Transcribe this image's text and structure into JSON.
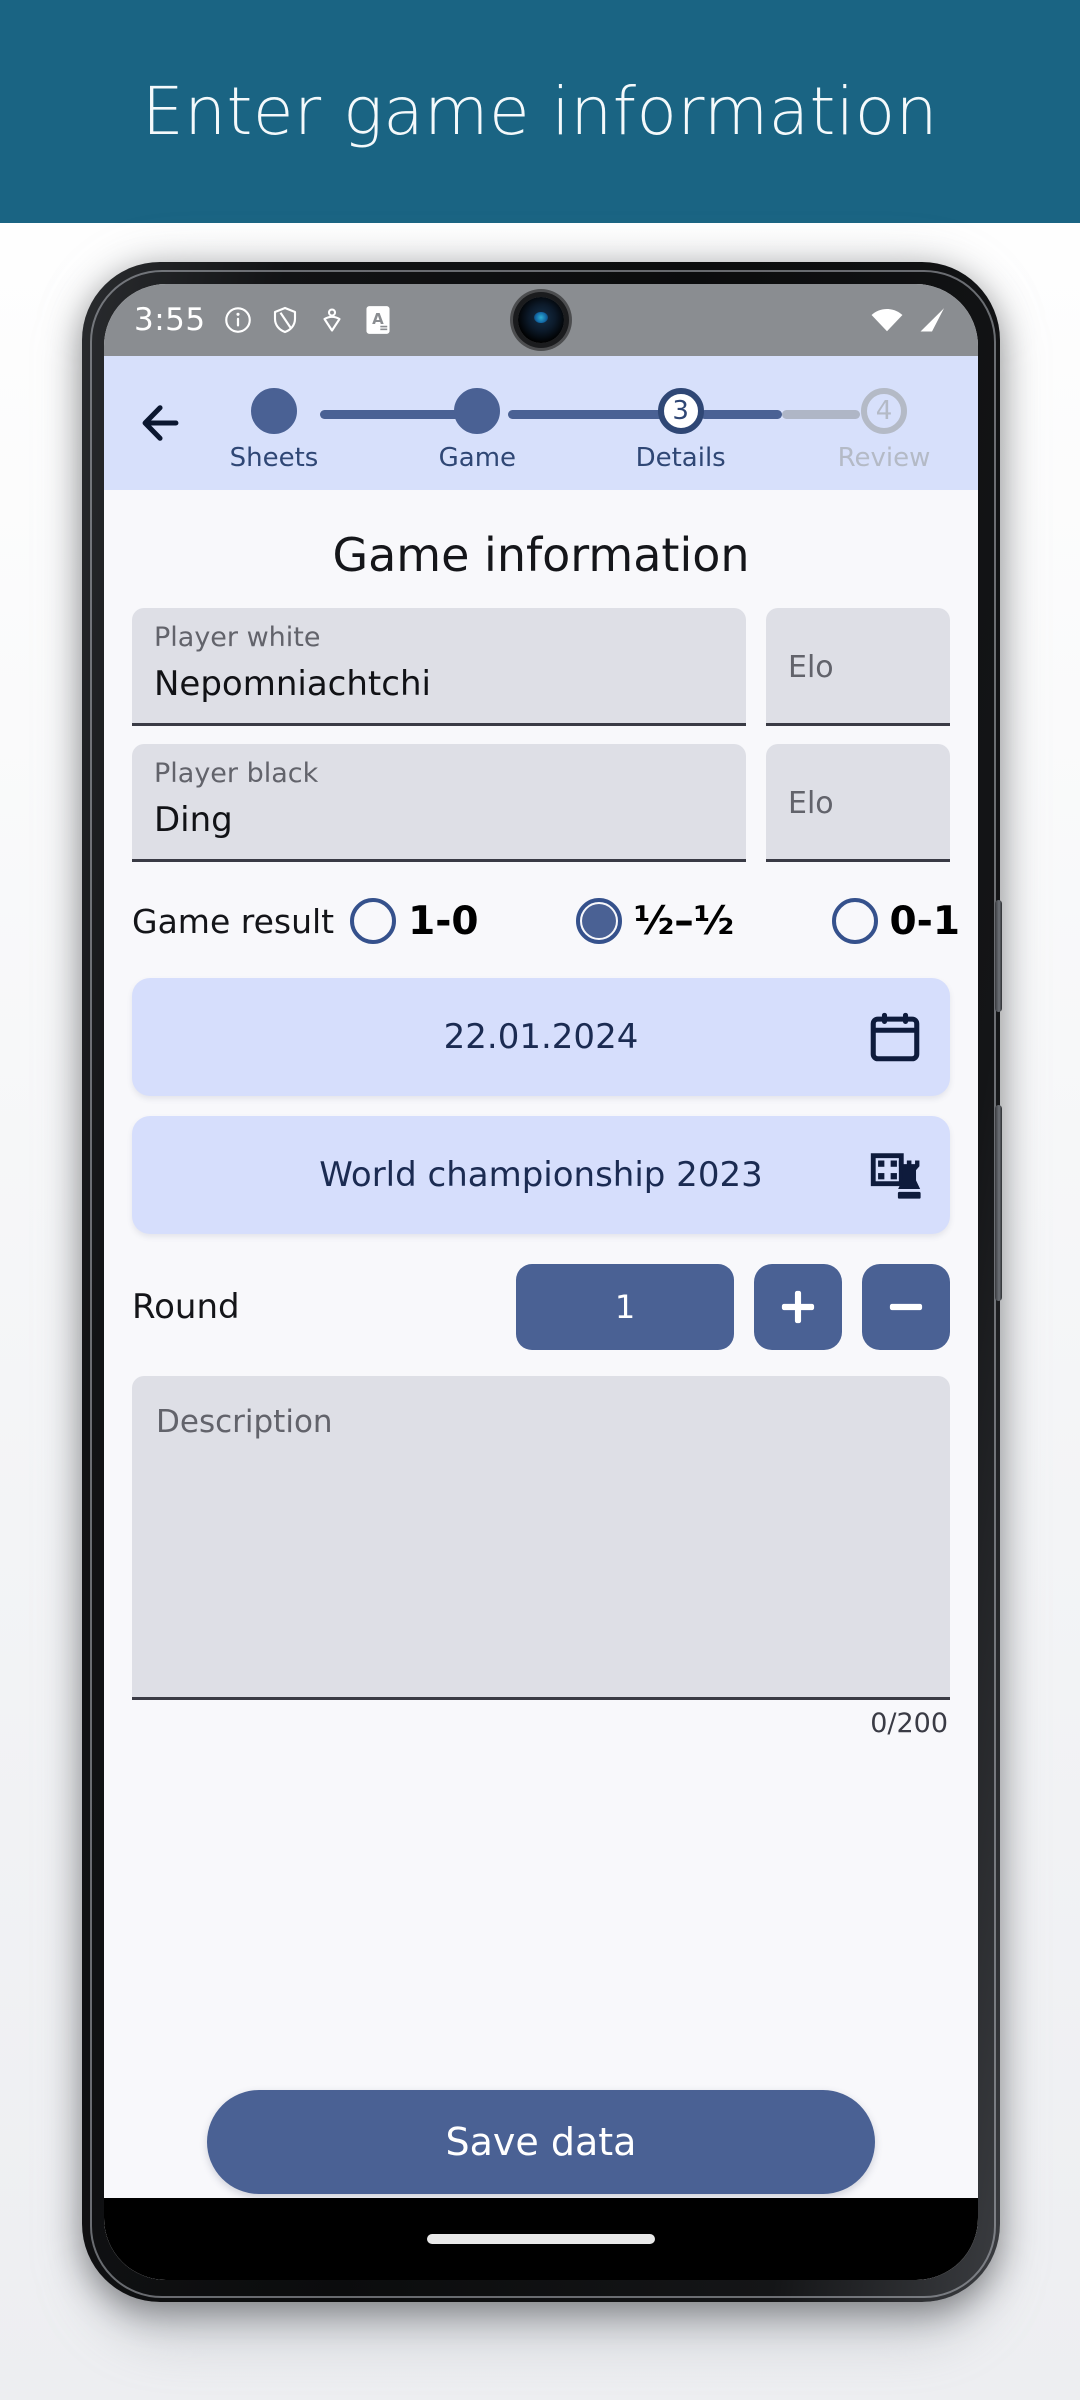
{
  "banner": {
    "title": "Enter game information",
    "bg_color": "#1A6483"
  },
  "status_bar": {
    "clock": "3:55",
    "left_icons": [
      "info-icon",
      "shield-icon",
      "person-location-icon",
      "app-badge-a-icon"
    ],
    "right_icons": [
      "wifi-icon",
      "cellular-signal-icon"
    ]
  },
  "stepper": {
    "back_label": "back-arrow",
    "steps": [
      {
        "number": "1",
        "label": "Sheets",
        "state": "done"
      },
      {
        "number": "2",
        "label": "Game",
        "state": "done"
      },
      {
        "number": "3",
        "label": "Details",
        "state": "active"
      },
      {
        "number": "4",
        "label": "Review",
        "state": "todo"
      }
    ]
  },
  "main": {
    "title": "Game information",
    "player_white": {
      "label": "Player white",
      "value": "Nepomniachtchi"
    },
    "elo_white": {
      "placeholder": "Elo",
      "value": ""
    },
    "player_black": {
      "label": "Player black",
      "value": "Ding"
    },
    "elo_black": {
      "placeholder": "Elo",
      "value": ""
    },
    "game_result": {
      "label": "Game result",
      "options": [
        {
          "text": "1-0",
          "selected": false
        },
        {
          "text": "½–½",
          "selected": true
        },
        {
          "text": "0-1",
          "selected": false
        }
      ]
    },
    "date": {
      "value": "22.01.2024",
      "icon": "calendar-icon"
    },
    "tournament": {
      "value": "World championship 2023",
      "icon": "chessboard-rook-icon"
    },
    "round": {
      "label": "Round",
      "value": "1",
      "increment": "+",
      "decrement": "–"
    },
    "description": {
      "placeholder": "Description",
      "value": "",
      "counter": "0/200"
    },
    "save_button": "Save data"
  },
  "colors": {
    "banner": "#1A6483",
    "accent": "#4A6194",
    "accent_dark": "#2F4775",
    "field_bg": "#DEDFE6",
    "picker_bg": "#D6DEFC",
    "stepper_bg": "#D7E0FB",
    "muted": "#B4BAC6"
  }
}
